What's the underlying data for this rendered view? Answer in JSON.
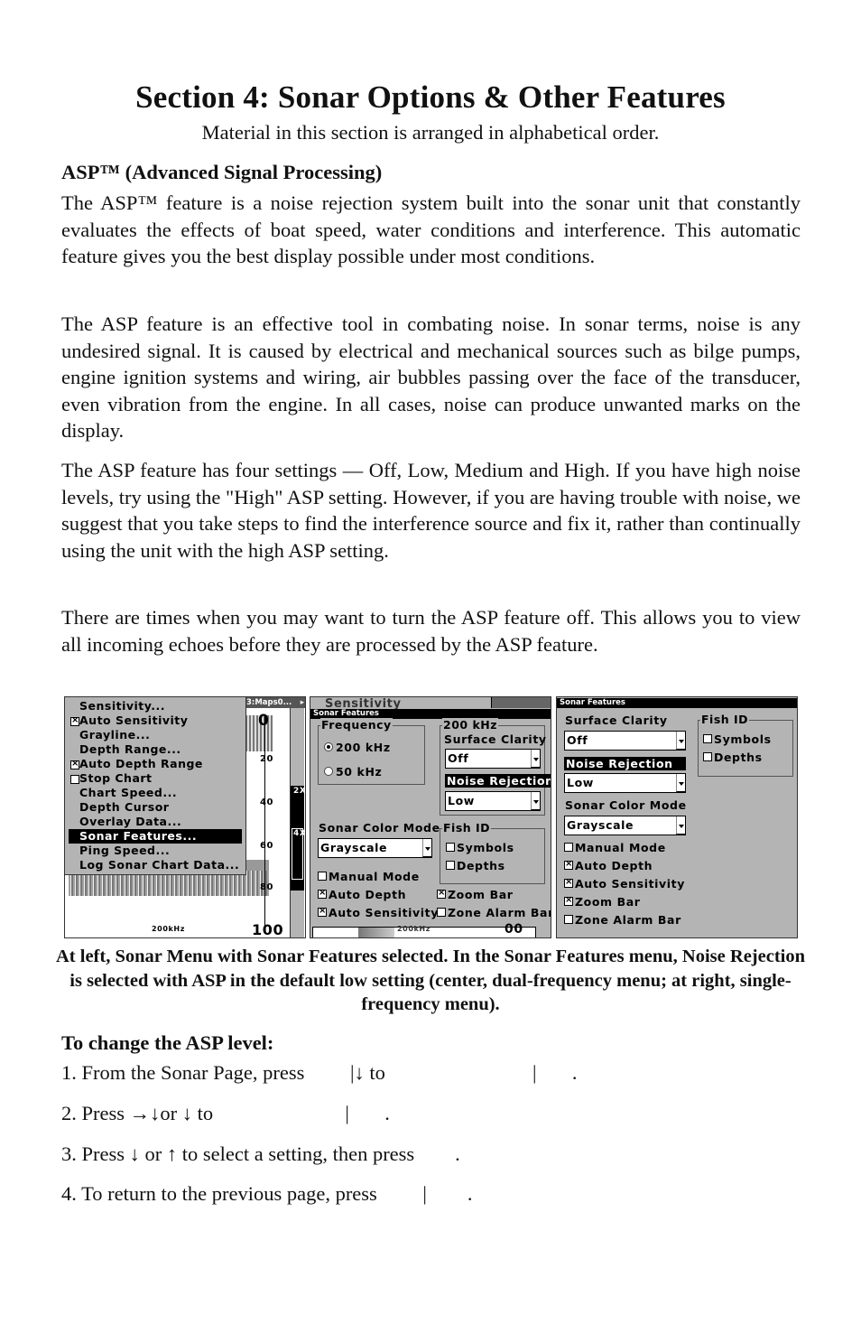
{
  "page": {
    "title": "Section 4: Sonar Options & Other Features",
    "subtitle": "Material in this section is arranged in alphabetical order.",
    "heading": "ASP™ (Advanced Signal Processing)",
    "paragraphs": [
      "The ASP™ feature is a noise rejection system built into the sonar unit that constantly evaluates the effects of boat speed, water conditions and interference. This automatic feature gives you the best display possible under most conditions.",
      "The ASP feature is an effective tool in combating noise. In sonar terms, noise is any undesired signal. It is caused by electrical and mechanical sources such as bilge pumps, engine ignition systems and wiring, air bubbles passing over the face of the transducer, even vibration from the engine. In all cases, noise can produce unwanted marks on the display.",
      "The ASP feature has four settings — Off, Low, Medium and High. If you have high noise levels, try using the \"High\" ASP setting. However, if you are having trouble with noise, we suggest that you take steps to find the interference source and fix it, rather than continually using the unit with the high ASP setting.",
      "There are times when you may want to turn the ASP feature off. This allows you to view all incoming echoes before they are processed by the ASP feature."
    ],
    "caption": "At left, Sonar Menu with Sonar Features selected. In the Sonar Features menu, Noise Rejection is selected with ASP in the default low setting (center, dual-frequency menu; at right, single-frequency menu).",
    "steps_title": "To change the ASP level:",
    "steps": [
      "1. From the Sonar Page, press         |↓ to                             |       .",
      "2. Press →↓or ↓ to                          |       .",
      "3. Press ↓ or ↑ to select a setting, then press        .",
      "4. To return to the previous page, press         |        ."
    ]
  },
  "screens": {
    "sonar_menu": {
      "topbar_label": "3:Maps0...",
      "items": [
        {
          "label": "Sensitivity...",
          "checkbox": null
        },
        {
          "label": "Auto Sensitivity",
          "checkbox": true
        },
        {
          "label": "Grayline...",
          "checkbox": null
        },
        {
          "label": "Depth Range...",
          "checkbox": null
        },
        {
          "label": "Auto Depth Range",
          "checkbox": true
        },
        {
          "label": "Stop Chart",
          "checkbox": false
        },
        {
          "label": "Chart Speed...",
          "checkbox": null
        },
        {
          "label": "Depth Cursor",
          "checkbox": null
        },
        {
          "label": "Overlay Data...",
          "checkbox": null
        },
        {
          "label": "Sonar Features...",
          "checkbox": null,
          "selected": true
        },
        {
          "label": "Ping Speed...",
          "checkbox": null
        },
        {
          "label": "Log Sonar Chart Data...",
          "checkbox": null
        }
      ],
      "depth_labels": [
        "0",
        "20",
        "40",
        "60",
        "80",
        "100"
      ],
      "zoom_labels": [
        "2X",
        "4X"
      ],
      "frequency_label": "200kHz"
    },
    "dual_freq": {
      "behind_label": "Sensitivity",
      "title": "Sonar Features",
      "frequency_group": "Frequency",
      "freq_options": [
        {
          "label": "200 kHz",
          "selected": true
        },
        {
          "label": "50 kHz",
          "selected": false
        }
      ],
      "khz_group": "200 kHz",
      "surface_clarity_label": "Surface Clarity",
      "surface_clarity_value": "Off",
      "noise_rejection_label": "Noise Rejection",
      "noise_rejection_value": "Low",
      "color_mode_label": "Sonar Color Mode",
      "color_mode_value": "Grayscale",
      "fish_id_group": "Fish ID",
      "fish_id": [
        {
          "label": "Symbols",
          "checked": false
        },
        {
          "label": "Depths",
          "checked": false
        }
      ],
      "manual_mode": {
        "label": "Manual Mode",
        "checked": false
      },
      "auto_depth": {
        "label": "Auto Depth",
        "checked": true
      },
      "auto_sensitivity": {
        "label": "Auto Sensitivity",
        "checked": true
      },
      "zoom_bar": {
        "label": "Zoom Bar",
        "checked": true
      },
      "zone_alarm_bar": {
        "label": "Zone Alarm Bar",
        "checked": false
      },
      "bottom_freq": "200kHz",
      "bottom_depth": "00"
    },
    "single_freq": {
      "title": "Sonar Features",
      "surface_clarity_label": "Surface Clarity",
      "surface_clarity_value": "Off",
      "noise_rejection_label": "Noise Rejection",
      "noise_rejection_value": "Low",
      "color_mode_label": "Sonar Color Mode",
      "color_mode_value": "Grayscale",
      "fish_id_group": "Fish ID",
      "fish_id": [
        {
          "label": "Symbols",
          "checked": false
        },
        {
          "label": "Depths",
          "checked": false
        }
      ],
      "checks": [
        {
          "label": "Manual Mode",
          "checked": false
        },
        {
          "label": "Auto Depth",
          "checked": true
        },
        {
          "label": "Auto Sensitivity",
          "checked": true
        },
        {
          "label": "Zoom Bar",
          "checked": true
        },
        {
          "label": "Zone Alarm Bar",
          "checked": false
        }
      ]
    }
  }
}
